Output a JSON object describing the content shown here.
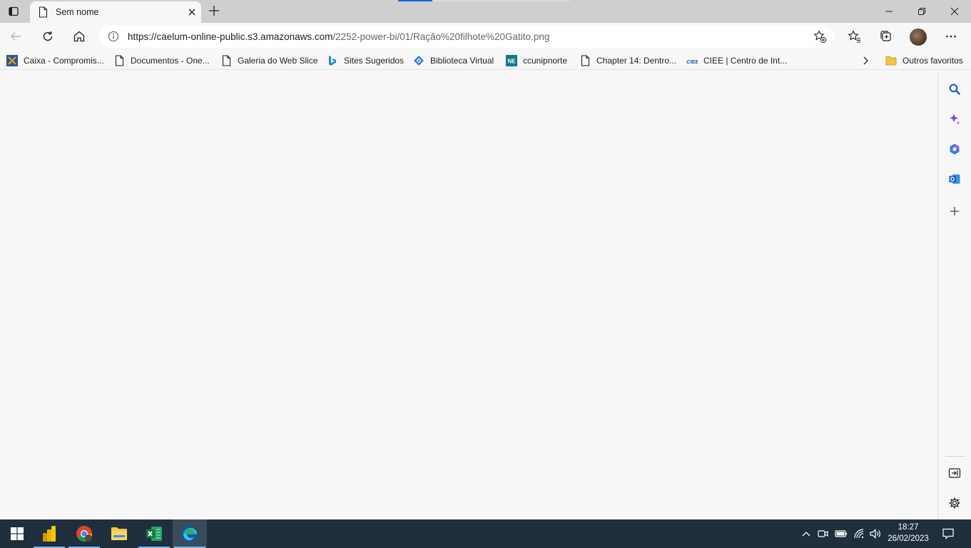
{
  "tab": {
    "title": "Sem nome"
  },
  "address_bar": {
    "url_host": "https://caelum-online-public.s3.amazonaws.com",
    "url_path": "/2252-power-bi/01/Ração%20filhote%20Gatito.png"
  },
  "loading_progress": 0.2,
  "favorites": [
    {
      "label": "Caixa - Compromis...",
      "icon": "caixa-icon"
    },
    {
      "label": "Documentos - One...",
      "icon": "page-icon"
    },
    {
      "label": "Galeria do Web Slice",
      "icon": "page-icon"
    },
    {
      "label": "Sites Sugeridos",
      "icon": "bing-icon"
    },
    {
      "label": "Biblioteca Virtual",
      "icon": "diamond-icon"
    },
    {
      "label": "ccunipnorte",
      "icon": "ne-icon"
    },
    {
      "label": "Chapter 14: Dentro...",
      "icon": "page-icon"
    },
    {
      "label": "CIEE | Centro de Int...",
      "icon": "ciee-icon"
    }
  ],
  "other_favorites": {
    "label": "Outros favoritos",
    "icon": "folder-icon"
  },
  "ne_icon_text": "NE",
  "ciee_icon_text": "CIEE",
  "taskbar": {
    "apps": [
      "power-bi-icon",
      "chrome-icon",
      "file-explorer-icon",
      "excel-icon",
      "edge-icon"
    ],
    "time": "18:27",
    "date": "26/02/2023"
  },
  "colors": {
    "accent": "#0a6ed1",
    "taskbar": "#1f2f3e",
    "tabstrip": "#cfcfcf",
    "content": "#f7f7f7"
  }
}
